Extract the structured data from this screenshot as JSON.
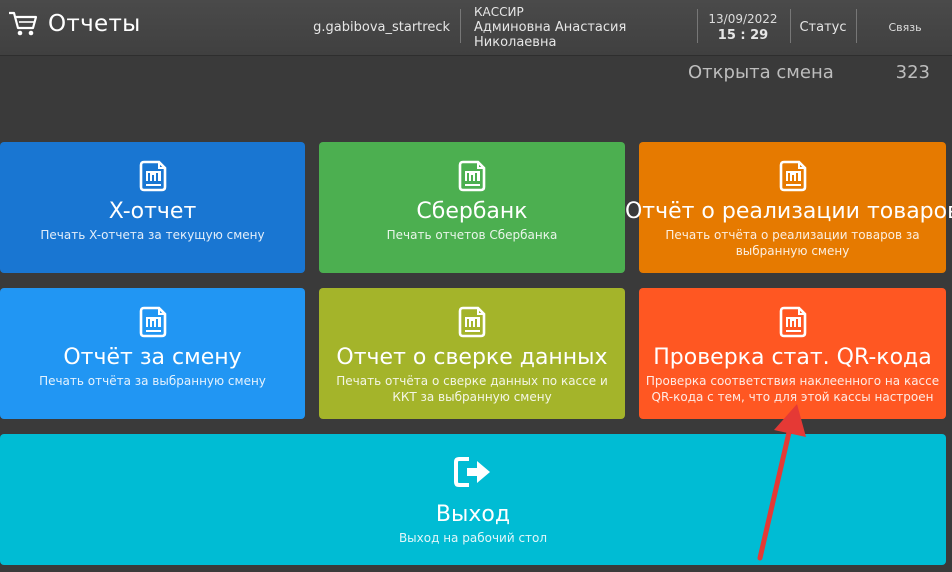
{
  "header": {
    "title": "Отчеты",
    "login": "g.gabibova_startreck",
    "role": "КАССИР",
    "cashier_name": "Админовна Анастасия Николаевна",
    "date": "13/09/2022",
    "time": "15 : 29",
    "status_label": "Статус",
    "link_label": "Связь"
  },
  "shift": {
    "label": "Открыта смена",
    "number": "323"
  },
  "tiles": [
    {
      "title": "X-отчет",
      "subtitle": "Печать X-отчета за текущую смену",
      "color": "#1976d2",
      "icon": "report-icon"
    },
    {
      "title": "Сбербанк",
      "subtitle": "Печать отчетов Сбербанка",
      "color": "#4caf50",
      "icon": "report-icon"
    },
    {
      "title": "Отчёт о реализации товаров",
      "subtitle": "Печать отчёта о реализации товаров за выбранную смену",
      "color": "#e67a00",
      "icon": "report-icon"
    },
    {
      "title": "Отчёт за смену",
      "subtitle": "Печать отчёта за выбранную смену",
      "color": "#2196f3",
      "icon": "report-icon"
    },
    {
      "title": "Отчет о сверке данных",
      "subtitle": "Печать отчёта о сверке данных по кассе и ККТ за выбранную смену",
      "color": "#a4b42a",
      "icon": "report-icon"
    },
    {
      "title": "Проверка стат. QR-кода",
      "subtitle": "Проверка соответствия наклеенного на кассе QR-кода с тем, что для этой кассы настроен",
      "color": "#ff5722",
      "icon": "report-icon"
    }
  ],
  "exit": {
    "title": "Выход",
    "subtitle": "Выход на рабочий стол",
    "color": "#00bcd4",
    "icon": "exit-icon"
  },
  "annotation": {
    "color": "#e53935",
    "icon": "red-arrow-annotation"
  }
}
